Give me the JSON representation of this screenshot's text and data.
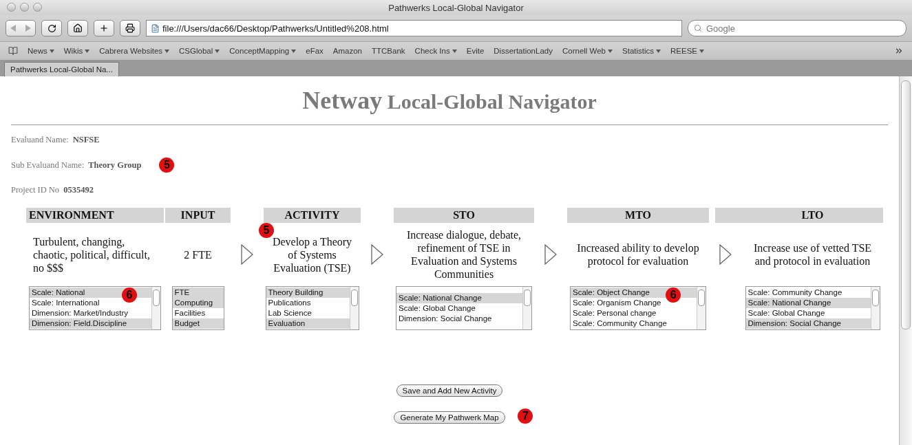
{
  "window": {
    "title": "Pathwerks Local-Global Navigator"
  },
  "toolbar": {
    "url": "file:///Users/dac66/Desktop/Pathwerks/Untitled%208.html",
    "search_placeholder": "Google"
  },
  "bookmarks": [
    {
      "label": "News",
      "menu": true
    },
    {
      "label": "Wikis",
      "menu": true
    },
    {
      "label": "Cabrera Websites",
      "menu": true
    },
    {
      "label": "CSGlobal",
      "menu": true
    },
    {
      "label": "ConceptMapping",
      "menu": true
    },
    {
      "label": "eFax",
      "menu": false
    },
    {
      "label": "Amazon",
      "menu": false
    },
    {
      "label": "TTCBank",
      "menu": false
    },
    {
      "label": "Check Ins",
      "menu": true
    },
    {
      "label": "Evite",
      "menu": false
    },
    {
      "label": "DissertationLady",
      "menu": false
    },
    {
      "label": "Cornell Web",
      "menu": true
    },
    {
      "label": "Statistics",
      "menu": true
    },
    {
      "label": "REESE",
      "menu": true
    }
  ],
  "tabs": [
    {
      "label": "Pathwerks Local-Global Na...",
      "selected": true
    }
  ],
  "page": {
    "heading_lead": "Netway",
    "heading_rest": "Local-Global Navigator",
    "fields": [
      {
        "label": "Evaluand Name:",
        "value": "NSFSE"
      },
      {
        "label": "Sub Evaluand Name:",
        "value": "Theory Group",
        "marker": "5"
      },
      {
        "label": "Project ID No",
        "value": "0535492"
      }
    ],
    "columns": [
      {
        "kind": "stage",
        "header": "ENVIRONMENT",
        "text": "Turbulent, changing, chaotic, political, difficult, no $$$",
        "left_aligned": true,
        "list_marker": "6",
        "options": [
          {
            "label": "Scale: National",
            "selected": true
          },
          {
            "label": "Scale: International",
            "selected": false
          },
          {
            "label": "Dimension: Market/Industry",
            "selected": false
          },
          {
            "label": "Dimension: Field.Discipline",
            "selected": true
          }
        ]
      },
      {
        "kind": "stage",
        "header": "INPUT",
        "text": "2 FTE",
        "left_aligned": false,
        "options": [
          {
            "label": "FTE",
            "selected": true
          },
          {
            "label": "Computing",
            "selected": true
          },
          {
            "label": "Facilities",
            "selected": false
          },
          {
            "label": "Budget",
            "selected": true
          }
        ]
      },
      {
        "kind": "arrow",
        "header_cell": false
      },
      {
        "kind": "stage",
        "header": "ACTIVITY",
        "text": "Develop a Theory of Systems Evaluation (TSE)",
        "left_aligned": false,
        "text_marker": "5",
        "options": [
          {
            "label": "Theory Building",
            "selected": true
          },
          {
            "label": "Publications",
            "selected": false
          },
          {
            "label": "Lab Science",
            "selected": false
          },
          {
            "label": "Evaluation",
            "selected": true
          }
        ]
      },
      {
        "kind": "arrow",
        "header_cell": false
      },
      {
        "kind": "stage",
        "header": "STO",
        "text": "Increase dialogue, debate, refinement of TSE in Evaluation and Systems Communities",
        "left_aligned": false,
        "options": [
          {
            "label": "Scale: National Change",
            "selected": true
          },
          {
            "label": "Scale: Global Change",
            "selected": false
          },
          {
            "label": "Dimension: Social Change",
            "selected": false
          }
        ]
      },
      {
        "kind": "arrow",
        "header_cell": false
      },
      {
        "kind": "stage",
        "header": "MTO",
        "text": "Increased ability to develop protocol for evaluation",
        "left_aligned": false,
        "list_marker": "6",
        "options": [
          {
            "label": "Scale: Object Change",
            "selected": true
          },
          {
            "label": "Scale: Organism Change",
            "selected": false
          },
          {
            "label": "Scale: Personal change",
            "selected": false
          },
          {
            "label": "Scale: Community Change",
            "selected": false
          }
        ]
      },
      {
        "kind": "arrow",
        "header_cell": true
      },
      {
        "kind": "stage",
        "header": "LTO",
        "text": "Increase use of vetted TSE and protocol in evaluation",
        "left_aligned": false,
        "options": [
          {
            "label": "Scale: Community Change",
            "selected": false
          },
          {
            "label": "Scale: National Change",
            "selected": true
          },
          {
            "label": "Scale: Global Change",
            "selected": false
          },
          {
            "label": "Dimension: Social Change",
            "selected": true
          }
        ]
      }
    ],
    "buttons": [
      {
        "label": "Save and Add New Activity"
      },
      {
        "label": "Generate My Pathwerk Map",
        "marker": "7"
      }
    ]
  }
}
